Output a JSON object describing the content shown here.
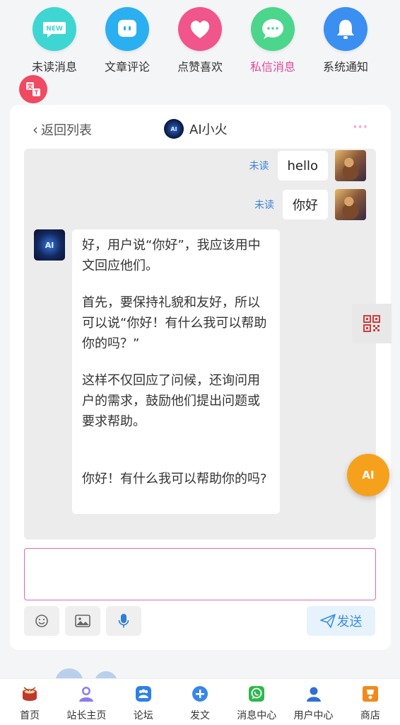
{
  "categories": [
    {
      "label": "未读消息",
      "color": "#3ed6d2",
      "icon": "new-icon",
      "badge": "NEW",
      "active": false
    },
    {
      "label": "文章评论",
      "color": "#2aaff0",
      "icon": "comment-icon",
      "active": false
    },
    {
      "label": "点赞喜欢",
      "color": "#f0558c",
      "icon": "heart-icon",
      "active": false
    },
    {
      "label": "私信消息",
      "color": "#4cd68c",
      "icon": "chat-bubble-icon",
      "active": true
    },
    {
      "label": "系统通知",
      "color": "#3a8ff0",
      "icon": "bell-icon",
      "active": false
    }
  ],
  "chat": {
    "back_label": "返回列表",
    "title": "AI小火",
    "avatar_text": "AI",
    "more_label": "∘∘∘",
    "messages": [
      {
        "from": "user",
        "text": "hello",
        "status": "未读"
      },
      {
        "from": "user",
        "text": "你好",
        "status": "未读"
      }
    ],
    "ai_reply": {
      "p1": "好，用户说“你好”，我应该用中文回应他们。",
      "p2": "首先，要保持礼貌和友好，所以可以说“你好！有什么我可以帮助你的吗？”",
      "p3": "这样不仅回应了问候，还询问用户的需求，鼓励他们提出问题或要求帮助。",
      "p4": "你好！有什么我可以帮助你的吗?"
    },
    "input_placeholder": "",
    "send_label": "发送"
  },
  "floating": {
    "ai_button": "AI"
  },
  "colors": {
    "accent_pink": "#e0499b",
    "send_blue": "#3b8fe0",
    "fab_orange": "#f6a11c"
  },
  "bottom_nav": [
    {
      "label": "首页",
      "icon": "drum-icon"
    },
    {
      "label": "站长主页",
      "icon": "person-icon"
    },
    {
      "label": "论坛",
      "icon": "forum-icon"
    },
    {
      "label": "发文",
      "icon": "plus-icon"
    },
    {
      "label": "消息中心",
      "icon": "message-icon"
    },
    {
      "label": "用户中心",
      "icon": "user-center-icon"
    },
    {
      "label": "商店",
      "icon": "shop-icon"
    }
  ]
}
